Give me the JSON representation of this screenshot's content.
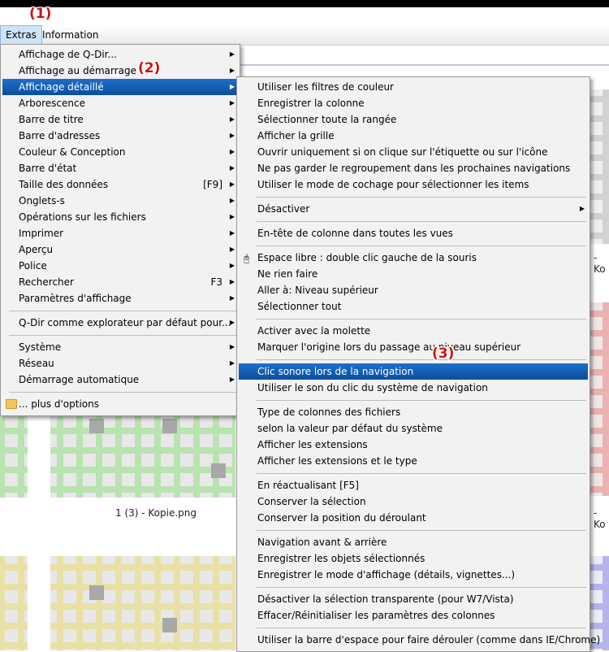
{
  "markers": {
    "m1": "(1)",
    "m2": "(2)",
    "m3": "(3)"
  },
  "menubar": {
    "extras": "Extras",
    "information": "Information"
  },
  "main_menu": {
    "items": [
      {
        "label": "Affichage de Q-Dir...",
        "submenu": true
      },
      {
        "label": "Affichage au démarrage",
        "submenu": true
      },
      {
        "label": "Affichage détaillé",
        "submenu": true,
        "highlighted": true
      },
      {
        "label": "Arborescence",
        "submenu": true
      },
      {
        "label": "Barre de titre",
        "submenu": true
      },
      {
        "label": "Barre d'adresses",
        "submenu": true
      },
      {
        "label": "Couleur & Conception",
        "submenu": true
      },
      {
        "label": "Barre d'état",
        "submenu": true
      },
      {
        "label": "Taille des données",
        "shortcut": "[F9]",
        "submenu": true
      },
      {
        "label": "Onglets-s",
        "submenu": true
      },
      {
        "label": "Opérations sur les fichiers",
        "submenu": true
      },
      {
        "label": "Imprimer",
        "submenu": true
      },
      {
        "label": "Aperçu",
        "submenu": true
      },
      {
        "label": "Police",
        "submenu": true
      },
      {
        "label": "Rechercher",
        "shortcut": "F3",
        "submenu": true
      },
      {
        "label": "Paramètres d'affichage",
        "submenu": true
      },
      {
        "label": "Q-Dir comme explorateur par défaut pour...",
        "submenu": true
      },
      {
        "label": "Système",
        "submenu": true
      },
      {
        "label": "Réseau",
        "submenu": true
      },
      {
        "label": "Démarrage automatique",
        "submenu": true
      },
      {
        "label": "... plus d'options",
        "icon": "folder-icon"
      }
    ]
  },
  "sub_menu": {
    "items": [
      {
        "label": "Utiliser les filtres de couleur"
      },
      {
        "label": "Enregistrer la colonne"
      },
      {
        "label": "Sélectionner toute la rangée"
      },
      {
        "label": "Afficher la grille"
      },
      {
        "label": "Ouvrir uniquement si on clique sur l'étiquette ou sur l'icône"
      },
      {
        "label": "Ne pas garder le regroupement dans les prochaines navigations"
      },
      {
        "label": "Utiliser le mode de cochage pour sélectionner les items"
      },
      {
        "label": "Désactiver",
        "submenu": true
      },
      {
        "label": "En-tête de colonne dans toutes les vues"
      },
      {
        "label": "Espace libre : double clic gauche de la souris",
        "icon": "mouse-icon"
      },
      {
        "label": "Ne rien faire"
      },
      {
        "label": "Aller à: Niveau supérieur"
      },
      {
        "label": "Sélectionner tout"
      },
      {
        "label": "Activer avec la molette"
      },
      {
        "label": "Marquer l'origine lors du passage au niveau supérieur"
      },
      {
        "label": "Clic sonore lors de la navigation",
        "highlighted": true
      },
      {
        "label": "Utiliser le son du clic du système de navigation"
      },
      {
        "label": "Type de colonnes des fichiers"
      },
      {
        "label": "selon la valeur par défaut du système"
      },
      {
        "label": "Afficher les extensions"
      },
      {
        "label": "Afficher les extensions et le type"
      },
      {
        "label": "En réactualisant [F5]"
      },
      {
        "label": "Conserver la sélection"
      },
      {
        "label": "Conserver la position du déroulant"
      },
      {
        "label": "Navigation avant & arrière"
      },
      {
        "label": "Enregistrer les objets sélectionnés"
      },
      {
        "label": "Enregistrer le mode d'affichage (détails, vignettes...)"
      },
      {
        "label": "Désactiver la sélection transparente (pour W7/Vista)"
      },
      {
        "label": "Effacer/Réinitialiser les paramètres des colonnes"
      },
      {
        "label": "Utiliser la barre d'espace pour faire dérouler (comme dans IE/Chrome)"
      }
    ]
  },
  "background": {
    "caption_center": "1 (3) - Kopie.png",
    "caption_right_1": "- Ko",
    "caption_right_2": "- Ko",
    "colors": {
      "green": "#b9e3b0",
      "yellow": "#e9e0a6",
      "gray": "#d2d2d2",
      "red": "#eab3b3",
      "blue": "#b5b5ea",
      "cell": "#a8a8a8"
    }
  },
  "colors": {
    "highlight": "#0a5aad",
    "marker": "#cc1111",
    "menu_bg": "#f2f2f2"
  }
}
